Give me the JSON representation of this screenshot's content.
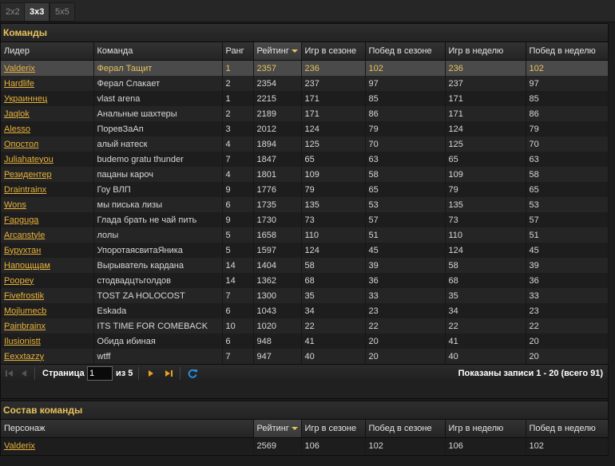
{
  "tabs": [
    "2x2",
    "3x3",
    "5x5"
  ],
  "teams": {
    "title": "Команды",
    "columns": [
      "Лидер",
      "Команда",
      "Ранг",
      "Рейтинг",
      "Игр в сезоне",
      "Побед в сезоне",
      "Игр в неделю",
      "Побед в неделю"
    ],
    "sorted_column": "Рейтинг",
    "rows": [
      [
        "Valderix",
        "Ферал Тащит",
        "1",
        "2357",
        "236",
        "102",
        "236",
        "102"
      ],
      [
        "Hardlife",
        "Ферал Слакает",
        "2",
        "2354",
        "237",
        "97",
        "237",
        "97"
      ],
      [
        "Украиннец",
        "vlast arena",
        "1",
        "2215",
        "171",
        "85",
        "171",
        "85"
      ],
      [
        "Jaqlok",
        "Анальные шахтеры",
        "2",
        "2189",
        "171",
        "86",
        "171",
        "86"
      ],
      [
        "Alesso",
        "ПоревЗаАп",
        "3",
        "2012",
        "124",
        "79",
        "124",
        "79"
      ],
      [
        "Опостол",
        "алый натеск",
        "4",
        "1894",
        "125",
        "70",
        "125",
        "70"
      ],
      [
        "Juliahateyou",
        "budemo gratu thunder",
        "7",
        "1847",
        "65",
        "63",
        "65",
        "63"
      ],
      [
        "Резидентер",
        "пацаны кароч",
        "4",
        "1801",
        "109",
        "58",
        "109",
        "58"
      ],
      [
        "Draintrainx",
        "Гоу ВЛП",
        "9",
        "1776",
        "79",
        "65",
        "79",
        "65"
      ],
      [
        "Wons",
        "мы писька лизы",
        "6",
        "1735",
        "135",
        "53",
        "135",
        "53"
      ],
      [
        "Fapguga",
        "Глада брать не чай пить",
        "9",
        "1730",
        "73",
        "57",
        "73",
        "57"
      ],
      [
        "Arcanstyle",
        "лолы",
        "5",
        "1658",
        "110",
        "51",
        "110",
        "51"
      ],
      [
        "Бурухтан",
        "УпоротаясвитаЯника",
        "5",
        "1597",
        "124",
        "45",
        "124",
        "45"
      ],
      [
        "Напощщам",
        "Вырыватель кардана",
        "14",
        "1404",
        "58",
        "39",
        "58",
        "39"
      ],
      [
        "Poopey",
        "стодвадцтьголдов",
        "14",
        "1362",
        "68",
        "36",
        "68",
        "36"
      ],
      [
        "Fivefrostik",
        "TOST ZA HOLOCOST",
        "7",
        "1300",
        "35",
        "33",
        "35",
        "33"
      ],
      [
        "Mojlumecb",
        "Eskada",
        "6",
        "1043",
        "34",
        "23",
        "34",
        "23"
      ],
      [
        "Painbrainx",
        "ITS TIME FOR COMEBACK",
        "10",
        "1020",
        "22",
        "22",
        "22",
        "22"
      ],
      [
        "Ilusionistt",
        "Обида ибиная",
        "6",
        "948",
        "41",
        "20",
        "41",
        "20"
      ],
      [
        "Eexxtazzy",
        "wtff",
        "7",
        "947",
        "40",
        "20",
        "40",
        "20"
      ]
    ],
    "pager": {
      "page_label": "Страница",
      "page_value": "1",
      "of_label": "из 5",
      "info": "Показаны записи 1 - 20 (всего 91)"
    }
  },
  "roster": {
    "title": "Состав команды",
    "columns": [
      "Персонаж",
      "Рейтинг",
      "Игр в сезоне",
      "Побед в сезоне",
      "Игр в неделю",
      "Побед в неделю"
    ],
    "sorted_column": "Рейтинг",
    "rows": [
      [
        "Valderix",
        "2569",
        "106",
        "102",
        "106",
        "102"
      ]
    ]
  },
  "colors": {
    "accent": "#e8c25a",
    "link": "#e8b23a",
    "refresh": "#2a8ad8"
  },
  "icons": [
    "first-page-icon",
    "prev-page-icon",
    "next-page-icon",
    "last-page-icon",
    "refresh-icon",
    "sort-desc-icon"
  ]
}
